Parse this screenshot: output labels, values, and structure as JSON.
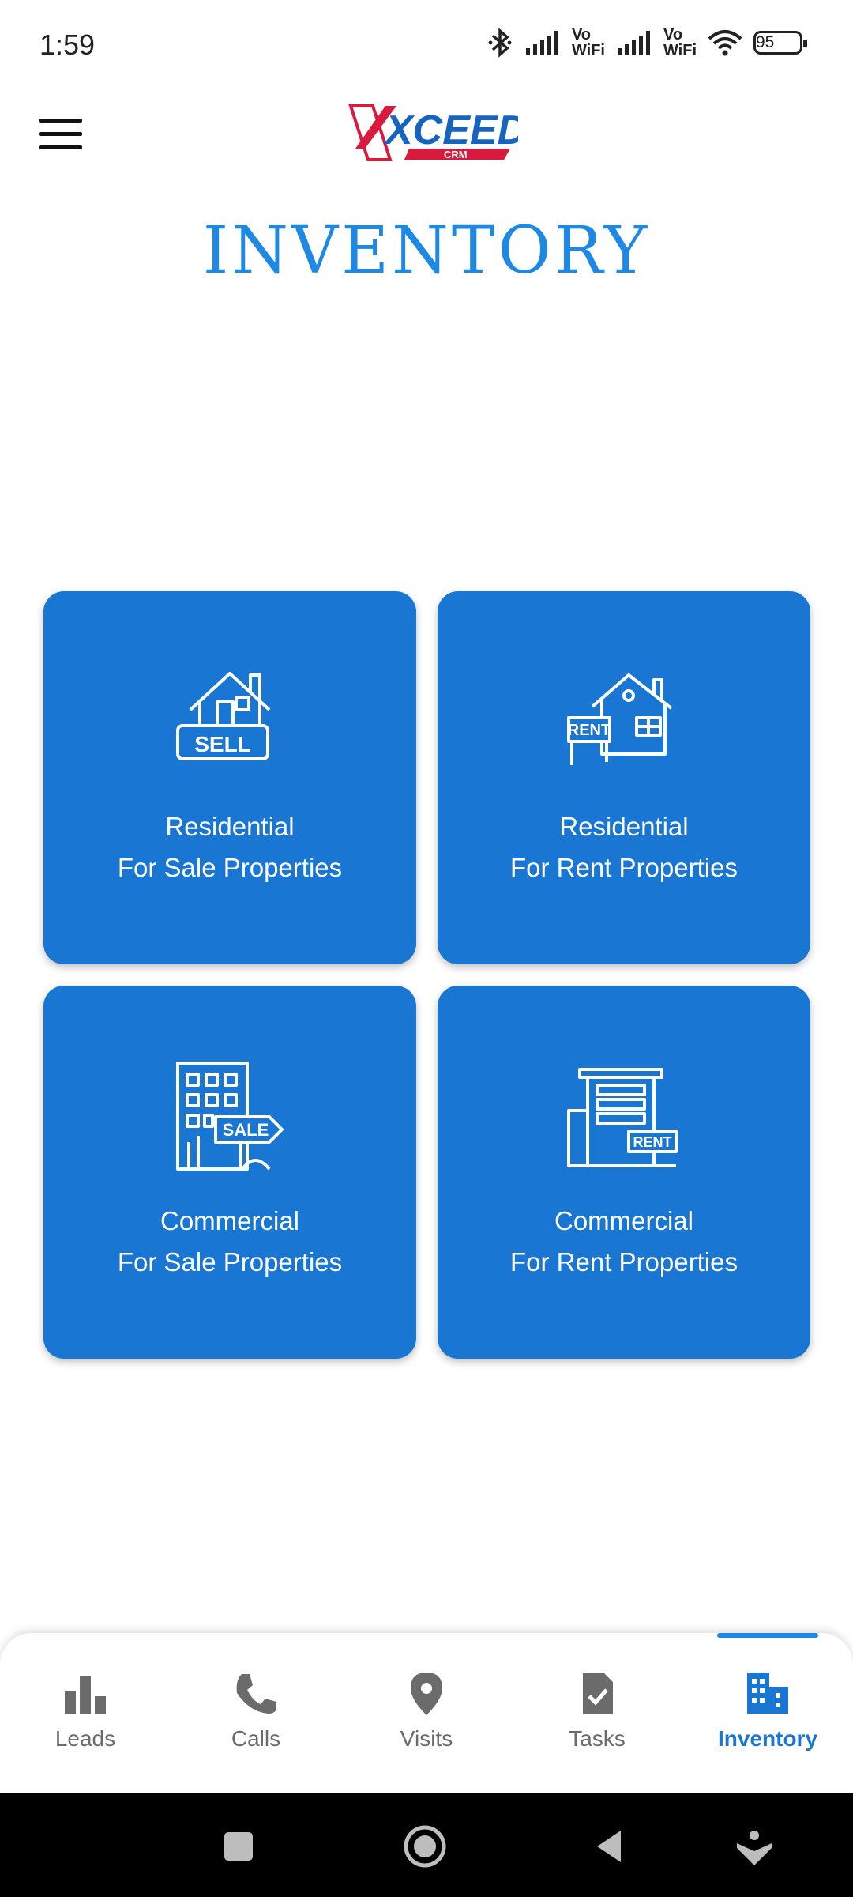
{
  "status_bar": {
    "time": "1:59",
    "vowifi_1": "Vo\nWiFi",
    "vowifi_2": "Vo\nWiFi",
    "battery": "95"
  },
  "header": {
    "logo_text": "XCEED",
    "logo_sub": "CRM",
    "menu_icon": "hamburger-menu-icon"
  },
  "page": {
    "title": "INVENTORY"
  },
  "cards": [
    {
      "line1": "Residential",
      "line2": "For Sale Properties",
      "icon": "house-sell-icon",
      "sign": "SELL"
    },
    {
      "line1": "Residential",
      "line2": "For Rent Properties",
      "icon": "house-rent-icon",
      "sign": "RENT"
    },
    {
      "line1": "Commercial",
      "line2": "For Sale Properties",
      "icon": "building-sale-icon",
      "sign": "SALE"
    },
    {
      "line1": "Commercial",
      "line2": "For Rent Properties",
      "icon": "building-rent-icon",
      "sign": "RENT"
    }
  ],
  "bottom_nav": {
    "items": [
      {
        "label": "Leads",
        "icon": "bar-chart-icon"
      },
      {
        "label": "Calls",
        "icon": "phone-icon"
      },
      {
        "label": "Visits",
        "icon": "location-pin-icon"
      },
      {
        "label": "Tasks",
        "icon": "task-clipboard-icon"
      },
      {
        "label": "Inventory",
        "icon": "buildings-icon"
      }
    ],
    "active_index": 4
  },
  "colors": {
    "primary": "#1976D2",
    "title": "#1E88E5",
    "logo_red": "#D81B3C",
    "logo_blue": "#1565C0"
  }
}
